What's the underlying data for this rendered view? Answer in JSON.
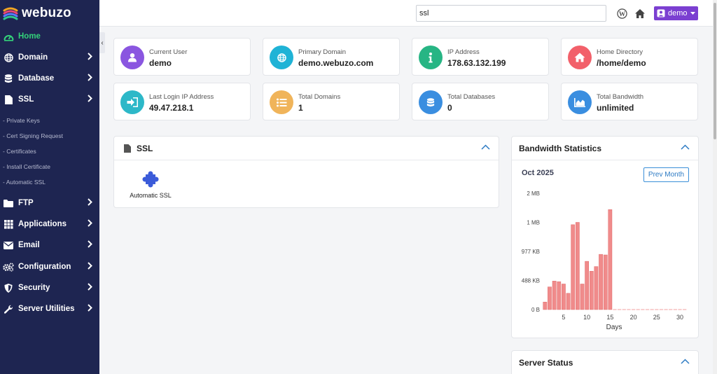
{
  "brand": {
    "name": "webuzo"
  },
  "sidebar": {
    "collapse_glyph": "‹",
    "items": [
      {
        "label": "Home",
        "icon": "dashboard-icon",
        "active": true
      },
      {
        "label": "Domain",
        "icon": "globe-icon"
      },
      {
        "label": "Database",
        "icon": "database-icon"
      },
      {
        "label": "SSL",
        "icon": "file-icon"
      },
      {
        "label": "FTP",
        "icon": "folder-icon"
      },
      {
        "label": "Applications",
        "icon": "grid-icon"
      },
      {
        "label": "Email",
        "icon": "envelope-icon"
      },
      {
        "label": "Configuration",
        "icon": "cogs-icon"
      },
      {
        "label": "Security",
        "icon": "shield-icon"
      },
      {
        "label": "Server Utilities",
        "icon": "wrench-icon"
      }
    ],
    "ssl_subitems": [
      "- Private Keys",
      "- Cert Signing Request",
      "- Certificates",
      "- Install Certificate",
      "- Automatic SSL"
    ]
  },
  "topbar": {
    "search_value": "ssl",
    "user_label": "demo",
    "icons": [
      "wordpress-icon",
      "home-icon"
    ]
  },
  "cards": [
    {
      "label": "Current User",
      "value": "demo",
      "icon": "user-icon",
      "color": "#8a56e0"
    },
    {
      "label": "Primary Domain",
      "value": "demo.webuzo.com",
      "icon": "globe-icon",
      "color": "#1fb3d6"
    },
    {
      "label": "IP Address",
      "value": "178.63.132.199",
      "icon": "info-icon",
      "color": "#27b584"
    },
    {
      "label": "Home Directory",
      "value": "/home/demo",
      "icon": "home-icon",
      "color": "#f2606a"
    },
    {
      "label": "Last Login IP Address",
      "value": "49.47.218.1",
      "icon": "sign-in-icon",
      "color": "#2db8c8"
    },
    {
      "label": "Total Domains",
      "value": "1",
      "icon": "list-icon",
      "color": "#f0b45a"
    },
    {
      "label": "Total Databases",
      "value": "0",
      "icon": "database-icon",
      "color": "#3a8ee0"
    },
    {
      "label": "Total Bandwidth",
      "value": "unlimited",
      "icon": "area-chart-icon",
      "color": "#3a8ee0"
    }
  ],
  "ssl_panel": {
    "title": "SSL",
    "apps": [
      {
        "label": "Automatic SSL",
        "icon": "puzzle-icon"
      }
    ]
  },
  "bandwidth_panel": {
    "title": "Bandwidth Statistics",
    "month": "Oct 2025",
    "prev_button": "Prev Month"
  },
  "server_status": {
    "title": "Server Status"
  },
  "colors": {
    "sidebar": "#1e2551",
    "active": "#34d27a",
    "bar": "#f08b8b",
    "accent": "#7b3fd1"
  },
  "chart_data": {
    "type": "bar",
    "xlabel": "Days",
    "ylabel": "",
    "x_ticks": [
      5,
      10,
      15,
      20,
      25,
      30
    ],
    "y_ticks": [
      "0 B",
      "488 KB",
      "977 KB",
      "1 MB",
      "2 MB"
    ],
    "ylim_kb": [
      0,
      2000
    ],
    "days": [
      1,
      2,
      3,
      4,
      5,
      6,
      7,
      8,
      9,
      10,
      11,
      12,
      13,
      14,
      15,
      16,
      17,
      18,
      19,
      20,
      21,
      22,
      23,
      24,
      25,
      26,
      27,
      28,
      29,
      30,
      31
    ],
    "values_kb": [
      130,
      390,
      490,
      480,
      440,
      280,
      1460,
      1500,
      440,
      830,
      660,
      740,
      950,
      940,
      1720,
      0,
      0,
      0,
      0,
      0,
      0,
      0,
      0,
      0,
      0,
      0,
      0,
      0,
      0,
      0,
      0
    ]
  }
}
